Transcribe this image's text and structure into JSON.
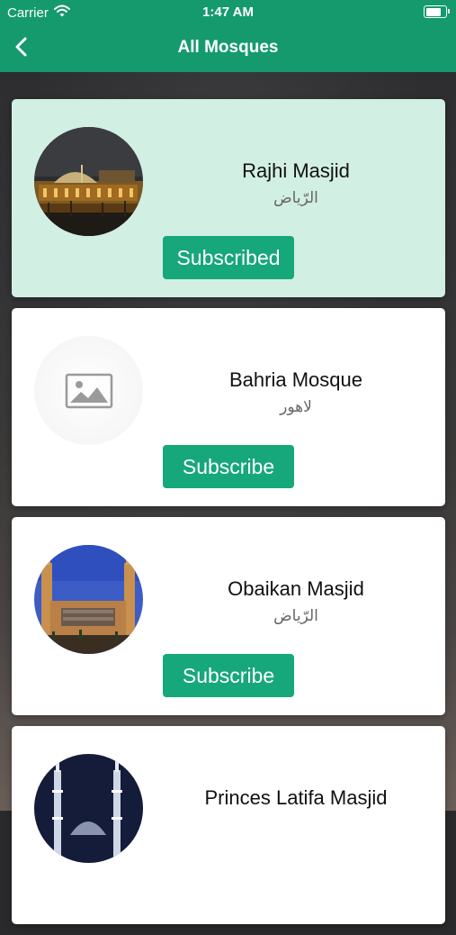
{
  "status_bar": {
    "carrier": "Carrier",
    "time": "1:47 AM",
    "battery_level": 0.92
  },
  "nav": {
    "title": "All Mosques"
  },
  "mosques": [
    {
      "name": "Rajhi Masjid",
      "city": "الرّياض",
      "button": "Subscribed",
      "subscribed": true,
      "image": "night-mosque-photo"
    },
    {
      "name": "Bahria Mosque",
      "city": "لاهور",
      "button": "Subscribe",
      "subscribed": false,
      "image": "image-placeholder-icon"
    },
    {
      "name": "Obaikan Masjid",
      "city": "الرّياض",
      "button": "Subscribe",
      "subscribed": false,
      "image": "day-mosque-photo"
    },
    {
      "name": "Princes Latifa Masjid",
      "city": "",
      "button": "",
      "subscribed": false,
      "image": "minarets-night-photo"
    }
  ],
  "colors": {
    "brand": "#159a6e",
    "button": "#16a77a",
    "subscribed_card": "#d2efe3"
  }
}
